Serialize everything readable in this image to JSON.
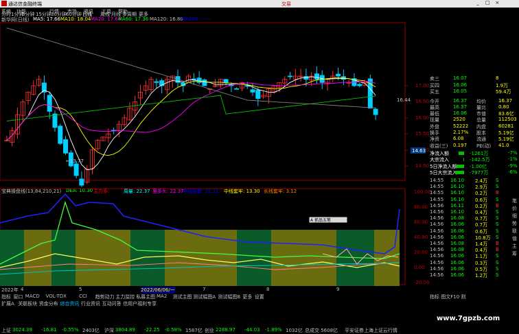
{
  "window": {
    "title": "通达信金融终端",
    "right_title": "交易",
    "controls": [
      "_",
      "□",
      "×"
    ]
  },
  "menu": [
    "系统",
    "功能",
    "行情",
    "市场",
    "资讯",
    "工具",
    "帮助"
  ],
  "periods": [
    "分时",
    "1分钟",
    "5分钟",
    "15分钟",
    "30分钟",
    "60分钟",
    "日线",
    "周线",
    "月线",
    "多周期",
    "更多"
  ],
  "toolbar": {
    "stock": "新华网(日线)",
    "ma": [
      {
        "label": "MA5: 17.66",
        "color": "#ffffff"
      },
      {
        "label": "MA10: 18.04",
        "color": "#ffff00"
      },
      {
        "label": "MA20: 17.64",
        "color": "#ff00ff"
      },
      {
        "label": "MA60: 17.36",
        "color": "#00ff00"
      },
      {
        "label": "MA120: 16.80",
        "color": "#c0c0c0"
      },
      {
        "label": "MA250: ------",
        "color": "#0000ff"
      }
    ]
  },
  "price_axis": [
    "17.00",
    "16.50",
    "16.00",
    "15.50",
    "15.00",
    "14.50"
  ],
  "price_labels": {
    "high": "16.44",
    "low": "13.77",
    "current": "14.63"
  },
  "indicator": {
    "name": "宝典操盘线(13,84,210,21)",
    "items": [
      {
        "label": "DEA: 10.30",
        "color": "#00ff00"
      },
      {
        "label": "主力多: ",
        "color": "#ff0000"
      },
      {
        "label": "周量: 22.37",
        "color": "#00ffff"
      },
      {
        "label": "里多头: 22.37",
        "color": "#ff00ff"
      },
      {
        "label": "中线操盘: 11.11",
        "color": "#0000ff"
      },
      {
        "label": "中线套牢: 13.30",
        "color": "#ffff00"
      },
      {
        "label": "长线套牢: 3.12",
        "color": "#ff8000"
      }
    ],
    "axis": [
      "100.00",
      "80.00",
      "60.00",
      "40.00",
      "20.00",
      "0.00",
      "-20.00"
    ],
    "popup": "A 抓品五笔"
  },
  "date_axis": [
    {
      "label": "2022年",
      "color": "#c0c0c0"
    },
    {
      "label": "4",
      "color": "#c0c0c0"
    },
    {
      "label": "5",
      "color": "#c0c0c0"
    },
    {
      "label": "2022/06/06/一",
      "color": "#ffff00"
    },
    {
      "label": "7",
      "color": "#c0c0c0"
    },
    {
      "label": "8",
      "color": "#c0c0c0"
    },
    {
      "label": "9",
      "color": "#c0c0c0"
    }
  ],
  "bottom_tabs_1": [
    "指标",
    "窗口",
    "MACD",
    "VOL-TDX",
    "CCI",
    "趋势动力",
    "主力监控",
    "私募主图",
    "MA2",
    "测试主图",
    "测试幅图A",
    "测试幅图B",
    "更多",
    "设置"
  ],
  "bottom_tabs_2": [
    "扩展A",
    "关联板块",
    "资金分布",
    "综合资讯",
    "行业资讯",
    "互动问答",
    "信用户福利专享"
  ],
  "quote": {
    "orders": [
      {
        "label": "卖三",
        "price": "16.07",
        "vol": "8"
      },
      {
        "label": "买四",
        "price": "16.06",
        "vol": "1.9万"
      },
      {
        "label": "买五",
        "price": "16.05",
        "vol": "59.4万"
      }
    ],
    "stats": [
      {
        "l1": "今开",
        "v1": "16.37",
        "l2": "均价",
        "v2": "16.37"
      },
      {
        "l1": "最高",
        "v1": "16.37",
        "l2": "量比",
        "v2": "0.80"
      },
      {
        "l1": "最低",
        "v1": "16.06",
        "l2": "市值",
        "v2": "83.6亿"
      },
      {
        "l1": "现量",
        "v1": "2520",
        "l2": "总量",
        "v2": "112503"
      },
      {
        "l1": "外盘",
        "v1": "52222",
        "l2": "内盘",
        "v2": "60281"
      },
      {
        "l1": "换手",
        "v1": "2.17%",
        "l2": "股本",
        "v2": "5.19亿"
      },
      {
        "l1": "净资",
        "v1": "6.08",
        "l2": "流通",
        "v2": "5.19亿"
      },
      {
        "l1": "收益(三)",
        "v1": "0.197",
        "l2": "PE(动)",
        "v2": "41.0"
      }
    ],
    "flows": [
      {
        "label": "净流入额",
        "value": "-1261万",
        "pct": "-7%",
        "bar": 0.35
      },
      {
        "label": "大宗流入",
        "value": "-142.5万",
        "pct": "-1%",
        "bar": 0.05
      },
      {
        "label": "5日净流入额",
        "value": "-1.00亿",
        "pct": "-9%",
        "bar": 0.45
      },
      {
        "label": "5日大宗流入",
        "value": "-7977万",
        "pct": "-6%",
        "bar": 0.55
      }
    ],
    "ticks": [
      {
        "time": "14:55",
        "price": "16.10",
        "vol": "2.4万",
        "bs": "S"
      },
      {
        "time": "14:55",
        "price": "16.10",
        "vol": "2.9万",
        "bs": "S"
      },
      {
        "time": "14:55",
        "price": "16.10",
        "vol": "0.2万",
        "bs": "B"
      },
      {
        "time": "14:55",
        "price": "16.10",
        "vol": "0.6万",
        "bs": "S"
      },
      {
        "time": "14:56",
        "price": "16.11",
        "vol": "0.2万",
        "bs": "B"
      },
      {
        "time": "14:56",
        "price": "16.10",
        "vol": "0.4万",
        "bs": "S"
      },
      {
        "time": "14:56",
        "price": "16.08",
        "vol": "0.7万",
        "bs": "S"
      },
      {
        "time": "14:56",
        "price": "16.06",
        "vol": "0.7万",
        "bs": "S"
      },
      {
        "time": "14:56",
        "price": "16.06",
        "vol": "0.6万",
        "bs": "S"
      },
      {
        "time": "14:56",
        "price": "16.06",
        "vol": "10.8万",
        "bs": "S"
      },
      {
        "time": "14:56",
        "price": "16.08",
        "vol": "1.4万",
        "bs": "B"
      },
      {
        "time": "14:56",
        "price": "16.08",
        "vol": "0.4万",
        "bs": "B"
      },
      {
        "time": "14:56",
        "price": "16.06",
        "vol": "1.1万",
        "bs": "S"
      },
      {
        "time": "14:56",
        "price": "16.06",
        "vol": "0.3万",
        "bs": "S"
      },
      {
        "time": "14:56",
        "price": "16.06",
        "vol": "0.5万",
        "bs": "S"
      },
      {
        "time": "14:56",
        "price": "16.06",
        "vol": "1.2万",
        "bs": "S"
      }
    ],
    "tabs": [
      "笔",
      "价",
      "细",
      "势",
      "联",
      "值",
      "主",
      "筹"
    ],
    "footer": [
      "指标",
      "图文F10",
      "割"
    ]
  },
  "status": {
    "items": [
      {
        "name": "上证",
        "value": "3024.39",
        "chg": "-16.81",
        "pct": "-0.55%",
        "amt": "2403亿"
      },
      {
        "name": "沪深",
        "value": "3804.89",
        "chg": "-22.25",
        "pct": "-0.58%",
        "amt": "1587亿"
      },
      {
        "name": "创业",
        "value": "2288.97",
        "chg": "-44.03",
        "pct": "-1.89%",
        "amt": "1032亿"
      }
    ],
    "ticker": "总成交  5608亿",
    "broker": "平安证券上海上证云行情"
  },
  "watermark": "www.7gpzb.com"
}
